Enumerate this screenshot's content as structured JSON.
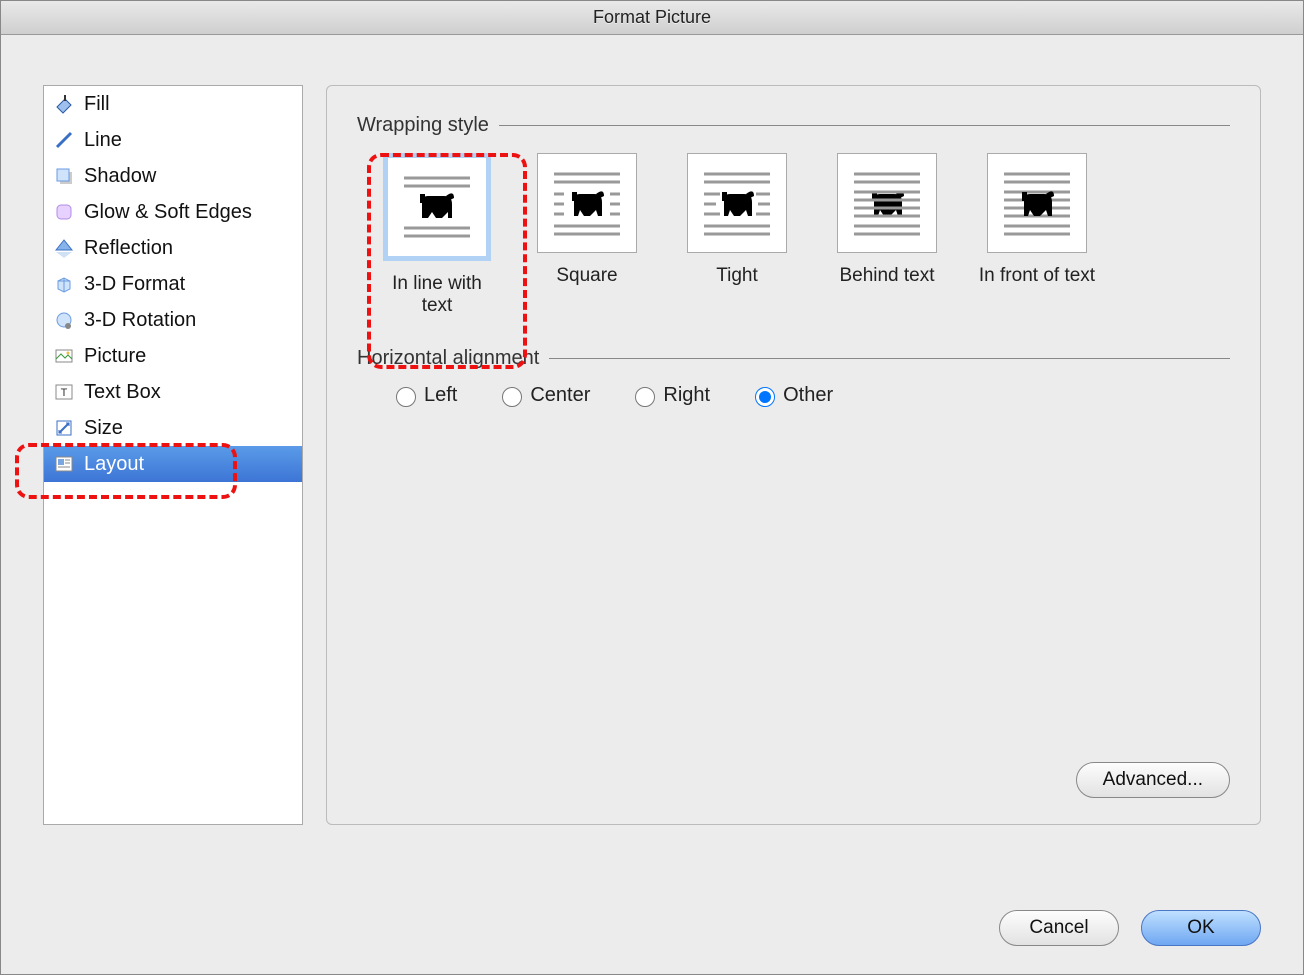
{
  "window": {
    "title": "Format Picture"
  },
  "sidebar": {
    "items": [
      {
        "label": "Fill",
        "selected": false
      },
      {
        "label": "Line",
        "selected": false
      },
      {
        "label": "Shadow",
        "selected": false
      },
      {
        "label": "Glow & Soft Edges",
        "selected": false
      },
      {
        "label": "Reflection",
        "selected": false
      },
      {
        "label": "3-D Format",
        "selected": false
      },
      {
        "label": "3-D Rotation",
        "selected": false
      },
      {
        "label": "Picture",
        "selected": false
      },
      {
        "label": "Text Box",
        "selected": false
      },
      {
        "label": "Size",
        "selected": false
      },
      {
        "label": "Layout",
        "selected": true
      }
    ]
  },
  "layout": {
    "wrapping_header": "Wrapping style",
    "wrapping_options": [
      {
        "label": "In line with text",
        "selected": true
      },
      {
        "label": "Square",
        "selected": false
      },
      {
        "label": "Tight",
        "selected": false
      },
      {
        "label": "Behind text",
        "selected": false
      },
      {
        "label": "In front of text",
        "selected": false
      }
    ],
    "halign_header": "Horizontal alignment",
    "halign_options": [
      {
        "label": "Left",
        "selected": false
      },
      {
        "label": "Center",
        "selected": false
      },
      {
        "label": "Right",
        "selected": false
      },
      {
        "label": "Other",
        "selected": true
      }
    ],
    "advanced_label": "Advanced..."
  },
  "footer": {
    "cancel": "Cancel",
    "ok": "OK"
  }
}
